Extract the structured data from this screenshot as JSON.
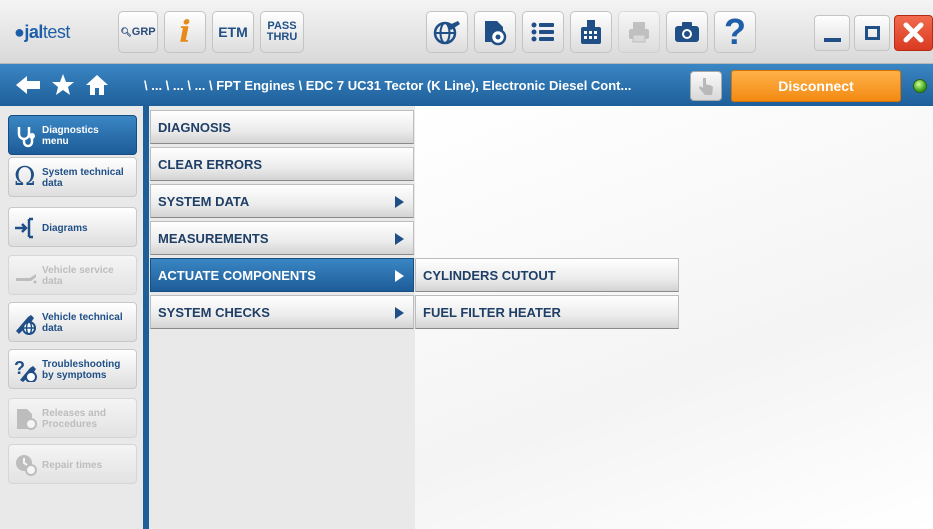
{
  "toolbar": {
    "logo_prefix": "",
    "logo_brand": "jal",
    "logo_suffix": "test",
    "grp_label": "GRP",
    "info_label": "i",
    "etm_label": "ETM",
    "pass_line1": "PASS",
    "pass_line2": "THRU",
    "help_label": "?"
  },
  "nav": {
    "breadcrumb": "\\ ... \\ ... \\ ... \\ FPT Engines \\ EDC 7 UC31 Tector (K Line), Electronic Diesel Cont...",
    "disconnect_label": "Disconnect"
  },
  "sidebar": {
    "items": [
      {
        "label_1": "Diagnostics",
        "label_2": "menu",
        "icon": "stethoscope-icon"
      },
      {
        "label_1": "System technical",
        "label_2": "data",
        "icon": "omega-icon"
      },
      {
        "label_1": "Diagrams",
        "label_2": "",
        "icon": "diagram-icon"
      },
      {
        "label_1": "Vehicle service",
        "label_2": "data",
        "icon": "oil-can-icon"
      },
      {
        "label_1": "Vehicle technical",
        "label_2": "data",
        "icon": "wrench-globe-icon"
      },
      {
        "label_1": "Troubleshooting",
        "label_2": "by symptoms",
        "icon": "troubleshoot-icon"
      },
      {
        "label_1": "Releases and",
        "label_2": "Procedures",
        "icon": "document-gear-icon"
      },
      {
        "label_1": "Repair times",
        "label_2": "",
        "icon": "clock-gear-icon"
      }
    ]
  },
  "menu": {
    "items": [
      {
        "label": "DIAGNOSIS"
      },
      {
        "label": "CLEAR ERRORS"
      },
      {
        "label": "SYSTEM DATA"
      },
      {
        "label": "MEASUREMENTS"
      },
      {
        "label": "ACTUATE COMPONENTS"
      },
      {
        "label": "SYSTEM CHECKS"
      }
    ],
    "submenu": [
      {
        "label": "CYLINDERS CUTOUT"
      },
      {
        "label": "FUEL FILTER HEATER"
      }
    ]
  },
  "colors": {
    "accent_blue": "#1e5f9a",
    "disconnect_orange": "#f28a12",
    "close_red": "#e8452c",
    "status_green": "#3fa81e"
  }
}
